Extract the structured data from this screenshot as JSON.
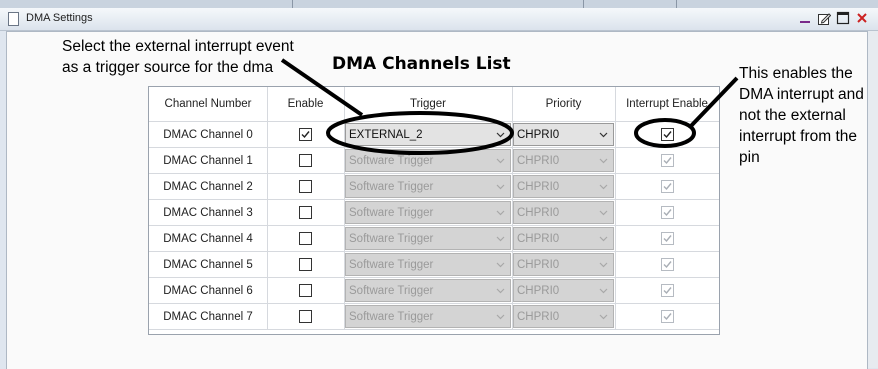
{
  "window": {
    "title": "DMA Settings"
  },
  "annotations": {
    "left_line1": "Select the external interrupt event",
    "left_line2": "as a trigger source for the dma",
    "right_line1": "This enables the",
    "right_line2": "DMA interrupt and",
    "right_line3": "not the external",
    "right_line4": "interrupt from the",
    "right_line5": "pin"
  },
  "heading": "DMA Channels List",
  "table": {
    "headers": [
      "Channel Number",
      "Enable",
      "Trigger",
      "Priority",
      "Interrupt Enable"
    ],
    "rows": [
      {
        "channel": "DMAC Channel 0",
        "enabled": true,
        "trigger": "EXTERNAL_2",
        "priority": "CHPRI0",
        "interrupt_enable": true
      },
      {
        "channel": "DMAC Channel 1",
        "enabled": false,
        "trigger": "Software Trigger",
        "priority": "CHPRI0",
        "interrupt_enable": true
      },
      {
        "channel": "DMAC Channel 2",
        "enabled": false,
        "trigger": "Software Trigger",
        "priority": "CHPRI0",
        "interrupt_enable": true
      },
      {
        "channel": "DMAC Channel 3",
        "enabled": false,
        "trigger": "Software Trigger",
        "priority": "CHPRI0",
        "interrupt_enable": true
      },
      {
        "channel": "DMAC Channel 4",
        "enabled": false,
        "trigger": "Software Trigger",
        "priority": "CHPRI0",
        "interrupt_enable": true
      },
      {
        "channel": "DMAC Channel 5",
        "enabled": false,
        "trigger": "Software Trigger",
        "priority": "CHPRI0",
        "interrupt_enable": true
      },
      {
        "channel": "DMAC Channel 6",
        "enabled": false,
        "trigger": "Software Trigger",
        "priority": "CHPRI0",
        "interrupt_enable": true
      },
      {
        "channel": "DMAC Channel 7",
        "enabled": false,
        "trigger": "Software Trigger",
        "priority": "CHPRI0",
        "interrupt_enable": true
      }
    ]
  },
  "icons": {
    "window": "document-icon",
    "minimize": "minimize-icon",
    "edit": "edit-icon",
    "maximize": "maximize-icon",
    "close": "close-icon",
    "checkmark": "checkmark-icon",
    "dropdown": "chevron-down-icon"
  },
  "colors": {
    "close_button": "#cc2222",
    "minimize_button": "#7a2a8a",
    "annotation_outline": "#000000",
    "disabled_combo": "#d4d4d4"
  }
}
